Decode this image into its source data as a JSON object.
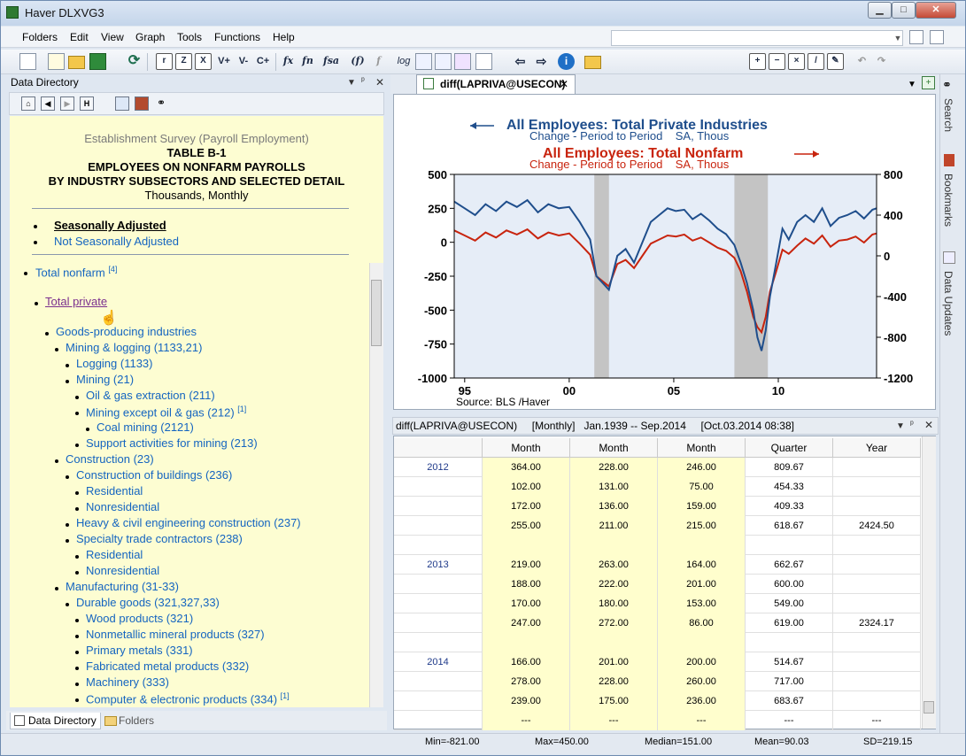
{
  "window": {
    "title": "Haver DLXVG3",
    "min_glyph": "▁",
    "max_glyph": "□",
    "close_glyph": "✕"
  },
  "menu": [
    "Folders",
    "Edit",
    "View",
    "Graph",
    "Tools",
    "Functions",
    "Help"
  ],
  "toolbar": {
    "buttons": [
      "r",
      "Z",
      "X",
      "V+",
      "V-",
      "C+",
      "fx",
      "fn",
      "fsa",
      "(f)",
      "f",
      "log"
    ]
  },
  "left_panel": {
    "title": "Data Directory",
    "header_icons": [
      "▼",
      "ᵖ",
      "✕"
    ],
    "nav": [
      "⌂",
      "◀",
      "▶",
      "H"
    ],
    "survey": "Establishment Survey (Payroll Employment)",
    "table_id": "TABLE B-1",
    "table_title1": "EMPLOYEES ON NONFARM PAYROLLS",
    "table_title2": "BY INDUSTRY SUBSECTORS AND SELECTED DETAIL",
    "units": "Thousands, Monthly",
    "adjust_sa": "Seasonally Adjusted",
    "adjust_nsa": "Not Seasonally Adjusted",
    "tree": {
      "total_nonfarm": "Total nonfarm",
      "total_nonfarm_note": "[4]",
      "total_private": "Total private",
      "goods": "Goods-producing industries",
      "mining_logging": "Mining & logging (1133,21)",
      "logging": "Logging (1133)",
      "mining": "Mining (21)",
      "oil_gas": "Oil & gas extraction (211)",
      "mining_except": "Mining except oil & gas (212)",
      "mining_except_note": "[1]",
      "coal": "Coal mining (2121)",
      "support": "Support activities for mining (213)",
      "construction": "Construction (23)",
      "construction_buildings": "Construction of buildings (236)",
      "residential1": "Residential",
      "nonresidential1": "Nonresidential",
      "heavy_civil": "Heavy & civil engineering construction (237)",
      "specialty": "Specialty trade contractors (238)",
      "residential2": "Residential",
      "nonresidential2": "Nonresidential",
      "manufacturing": "Manufacturing (31-33)",
      "durable": "Durable goods (321,327,33)",
      "wood": "Wood products (321)",
      "nonmetallic": "Nonmetallic mineral products (327)",
      "primary_metals": "Primary metals (331)",
      "fabricated": "Fabricated metal products (332)",
      "machinery": "Machinery (333)",
      "computer": "Computer & electronic products (334)",
      "computer_note": "[1]"
    },
    "tabs": {
      "directory": "Data Directory",
      "folders": "Folders"
    }
  },
  "graph_tab": {
    "label": "diff(LAPRIVA@USECON)",
    "close": "✕"
  },
  "chart_data": {
    "type": "line",
    "title1": "All Employees: Total Private Industries",
    "subtitle1": "Change - Period to Period    SA, Thous",
    "title2": "All Employees: Total Nonfarm",
    "subtitle2": "Change - Period to Period    SA, Thous",
    "source": "Source:  BLS /Haver",
    "x_ticks": [
      "95",
      "00",
      "05",
      "10"
    ],
    "x_tick_years": [
      1995,
      2000,
      2005,
      2010
    ],
    "x_range": [
      1994.5,
      2014.7
    ],
    "left_axis": {
      "ticks": [
        "500",
        "250",
        "0",
        "-250",
        "-500",
        "-750",
        "-1000"
      ],
      "range": [
        -1000,
        500
      ]
    },
    "right_axis": {
      "ticks": [
        "800",
        "400",
        "0",
        "-400",
        "-800",
        "-1200"
      ],
      "range": [
        -1200,
        800
      ]
    },
    "recessions": [
      [
        2001.2,
        2001.9
      ],
      [
        2007.9,
        2009.5
      ]
    ],
    "series": [
      {
        "name": "All Employees: Total Private Industries",
        "axis": "left",
        "color": "#1f4e8c",
        "x": [
          1994.5,
          1995.0,
          1995.5,
          1996.0,
          1996.5,
          1997.0,
          1997.5,
          1998.0,
          1998.5,
          1999.0,
          1999.5,
          2000.0,
          2000.5,
          2001.0,
          2001.3,
          2001.6,
          2001.9,
          2002.3,
          2002.7,
          2003.1,
          2003.5,
          2003.9,
          2004.3,
          2004.7,
          2005.1,
          2005.5,
          2005.9,
          2006.3,
          2006.7,
          2007.1,
          2007.5,
          2007.9,
          2008.2,
          2008.5,
          2008.8,
          2009.0,
          2009.2,
          2009.4,
          2009.6,
          2009.9,
          2010.2,
          2010.5,
          2010.9,
          2011.3,
          2011.7,
          2012.1,
          2012.5,
          2012.9,
          2013.3,
          2013.7,
          2014.1,
          2014.5,
          2014.7
        ],
        "values": [
          300,
          250,
          200,
          280,
          230,
          300,
          260,
          310,
          220,
          280,
          250,
          260,
          150,
          20,
          -250,
          -300,
          -350,
          -100,
          -50,
          -150,
          0,
          150,
          200,
          250,
          230,
          240,
          170,
          210,
          160,
          100,
          60,
          -20,
          -150,
          -300,
          -500,
          -700,
          -800,
          -650,
          -400,
          -150,
          100,
          20,
          150,
          200,
          150,
          250,
          120,
          180,
          200,
          230,
          175,
          240,
          250
        ]
      },
      {
        "name": "All Employees: Total Nonfarm",
        "axis": "right",
        "color": "#c8240e",
        "x": [
          1994.5,
          1995.0,
          1995.5,
          1996.0,
          1996.5,
          1997.0,
          1997.5,
          1998.0,
          1998.5,
          1999.0,
          1999.5,
          2000.0,
          2000.5,
          2001.0,
          2001.3,
          2001.6,
          2001.9,
          2002.3,
          2002.7,
          2003.1,
          2003.5,
          2003.9,
          2004.3,
          2004.7,
          2005.1,
          2005.5,
          2005.9,
          2006.3,
          2006.7,
          2007.1,
          2007.5,
          2007.9,
          2008.2,
          2008.5,
          2008.8,
          2009.0,
          2009.2,
          2009.4,
          2009.6,
          2009.9,
          2010.2,
          2010.5,
          2010.9,
          2011.3,
          2011.7,
          2012.1,
          2012.5,
          2012.9,
          2013.3,
          2013.7,
          2014.1,
          2014.5,
          2014.7
        ],
        "values": [
          250,
          200,
          150,
          230,
          180,
          250,
          210,
          260,
          170,
          230,
          200,
          220,
          120,
          10,
          -200,
          -250,
          -300,
          -80,
          -40,
          -120,
          0,
          120,
          160,
          200,
          190,
          210,
          150,
          180,
          130,
          80,
          50,
          -20,
          -150,
          -350,
          -600,
          -700,
          -750,
          -600,
          -350,
          -150,
          60,
          20,
          100,
          170,
          120,
          200,
          90,
          150,
          160,
          190,
          130,
          210,
          220
        ]
      }
    ]
  },
  "table_panel": {
    "header": "diff(LAPRIVA@USECON)     [Monthly]   Jan.1939 -- Sep.2014     [Oct.03.2014 08:38]",
    "columns": [
      "",
      "Month",
      "Month",
      "Month",
      "Quarter",
      "Year"
    ],
    "rows": [
      [
        "2012",
        "364.00",
        "228.00",
        "246.00",
        "809.67",
        ""
      ],
      [
        "",
        "102.00",
        "131.00",
        "75.00",
        "454.33",
        ""
      ],
      [
        "",
        "172.00",
        "136.00",
        "159.00",
        "409.33",
        ""
      ],
      [
        "",
        "255.00",
        "211.00",
        "215.00",
        "618.67",
        "2424.50"
      ],
      [
        "",
        "",
        "",
        "",
        "",
        ""
      ],
      [
        "2013",
        "219.00",
        "263.00",
        "164.00",
        "662.67",
        ""
      ],
      [
        "",
        "188.00",
        "222.00",
        "201.00",
        "600.00",
        ""
      ],
      [
        "",
        "170.00",
        "180.00",
        "153.00",
        "549.00",
        ""
      ],
      [
        "",
        "247.00",
        "272.00",
        "86.00",
        "619.00",
        "2324.17"
      ],
      [
        "",
        "",
        "",
        "",
        "",
        ""
      ],
      [
        "2014",
        "166.00",
        "201.00",
        "200.00",
        "514.67",
        ""
      ],
      [
        "",
        "278.00",
        "228.00",
        "260.00",
        "717.00",
        ""
      ],
      [
        "",
        "239.00",
        "175.00",
        "236.00",
        "683.67",
        ""
      ],
      [
        "",
        "---",
        "---",
        "---",
        "---",
        "---"
      ]
    ]
  },
  "status": {
    "min": "Min=-821.00",
    "max": "Max=450.00",
    "median": "Median=151.00",
    "mean": "Mean=90.03",
    "sd": "SD=219.15"
  },
  "right_rail": {
    "search": "Search",
    "bookmarks": "Bookmarks",
    "updates": "Data Updates"
  }
}
